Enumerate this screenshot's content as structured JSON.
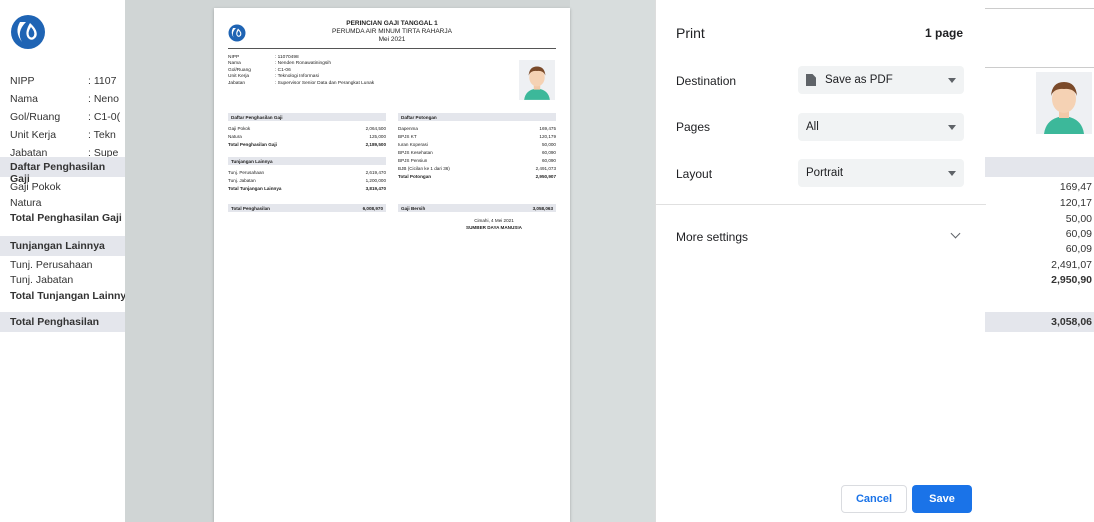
{
  "background": {
    "info": [
      {
        "label": "NIPP",
        "value": ": 1107"
      },
      {
        "label": "Nama",
        "value": ": Neno"
      },
      {
        "label": "Gol/Ruang",
        "value": ": C1-0("
      },
      {
        "label": "Unit Kerja",
        "value": ": Tekn"
      },
      {
        "label": "Jabatan",
        "value": ": Supe"
      }
    ],
    "sec_income": "Daftar Penghasilan Gaji",
    "gaji_pokok": "Gaji Pokok",
    "natura": "Natura",
    "total_penghasilan_gaji": "Total Penghasilan Gaji",
    "sec_tunjangan": "Tunjangan Lainnya",
    "tunj_perusahaan": "Tunj. Perusahaan",
    "tunj_jabatan": "Tunj. Jabatan",
    "total_tunjangan": "Total Tunjangan Lainnya",
    "total_penghasilan": "Total Penghasilan",
    "right_numbers": [
      "169,47",
      "120,17",
      "50,00",
      "60,09",
      "60,09",
      "2,491,07",
      "2,950,90"
    ],
    "right_total": "3,058,06"
  },
  "sheet": {
    "title": "PERINCIAN GAJI TANGGAL 1",
    "company": "PERUMDA AIR MINUM TIRTA RAHARJA",
    "period": "Mei 2021",
    "info": [
      {
        "label": "NIPP",
        "value": ": 11070498"
      },
      {
        "label": "Nama",
        "value": ": Nenden Ronawatiningsih"
      },
      {
        "label": "Gol/Ruang",
        "value": ": C1-06"
      },
      {
        "label": "Unit Kerja",
        "value": ": Teknologi Informasi"
      },
      {
        "label": "Jabatan",
        "value": ": Supervisor Senior Data dan Perangkat Lunak"
      }
    ],
    "income_header": "Daftar Penghasilan Gaji",
    "income": [
      {
        "label": "Gaji Pokok",
        "value": "2,064,500"
      },
      {
        "label": "Natura",
        "value": "125,000"
      }
    ],
    "income_total": {
      "label": "Total Penghasilan Gaji",
      "value": "2,189,500"
    },
    "allow_header": "Tunjangan Lainnya",
    "allow": [
      {
        "label": "Tunj. Perusahaan",
        "value": "2,619,470"
      },
      {
        "label": "Tunj. Jabatan",
        "value": "1,200,000"
      }
    ],
    "allow_total": {
      "label": "Total Tunjangan Lainnya",
      "value": "3,819,470"
    },
    "gross_total": {
      "label": "Total Penghasilan",
      "value": "6,008,970"
    },
    "ded_header": "Daftar Potongan",
    "deductions": [
      {
        "label": "Dapenma",
        "value": "169,475"
      },
      {
        "label": "BPJS KT",
        "value": "120,179"
      },
      {
        "label": "Iuran Koperasi",
        "value": "50,000"
      },
      {
        "label": "BPJS Kesehatan",
        "value": "60,090"
      },
      {
        "label": "BPJS Pensiun",
        "value": "60,090"
      },
      {
        "label": "BJB (Cicilan ke 1 dari 36)",
        "value": "2,491,073"
      }
    ],
    "ded_total": {
      "label": "Total Potongan",
      "value": "2,950,907"
    },
    "net": {
      "label": "Gaji Bersih",
      "value": "3,058,063"
    },
    "sign_place": "Cimahi, 4 Mei 2021",
    "sign_dept": "SUMBER DAYA MANUSIA"
  },
  "panel": {
    "title": "Print",
    "page_count": "1 page",
    "destination_label": "Destination",
    "destination_value": "Save as PDF",
    "pages_label": "Pages",
    "pages_value": "All",
    "layout_label": "Layout",
    "layout_value": "Portrait",
    "more_settings": "More settings",
    "cancel": "Cancel",
    "save": "Save",
    "accent": "#1a73e8"
  }
}
